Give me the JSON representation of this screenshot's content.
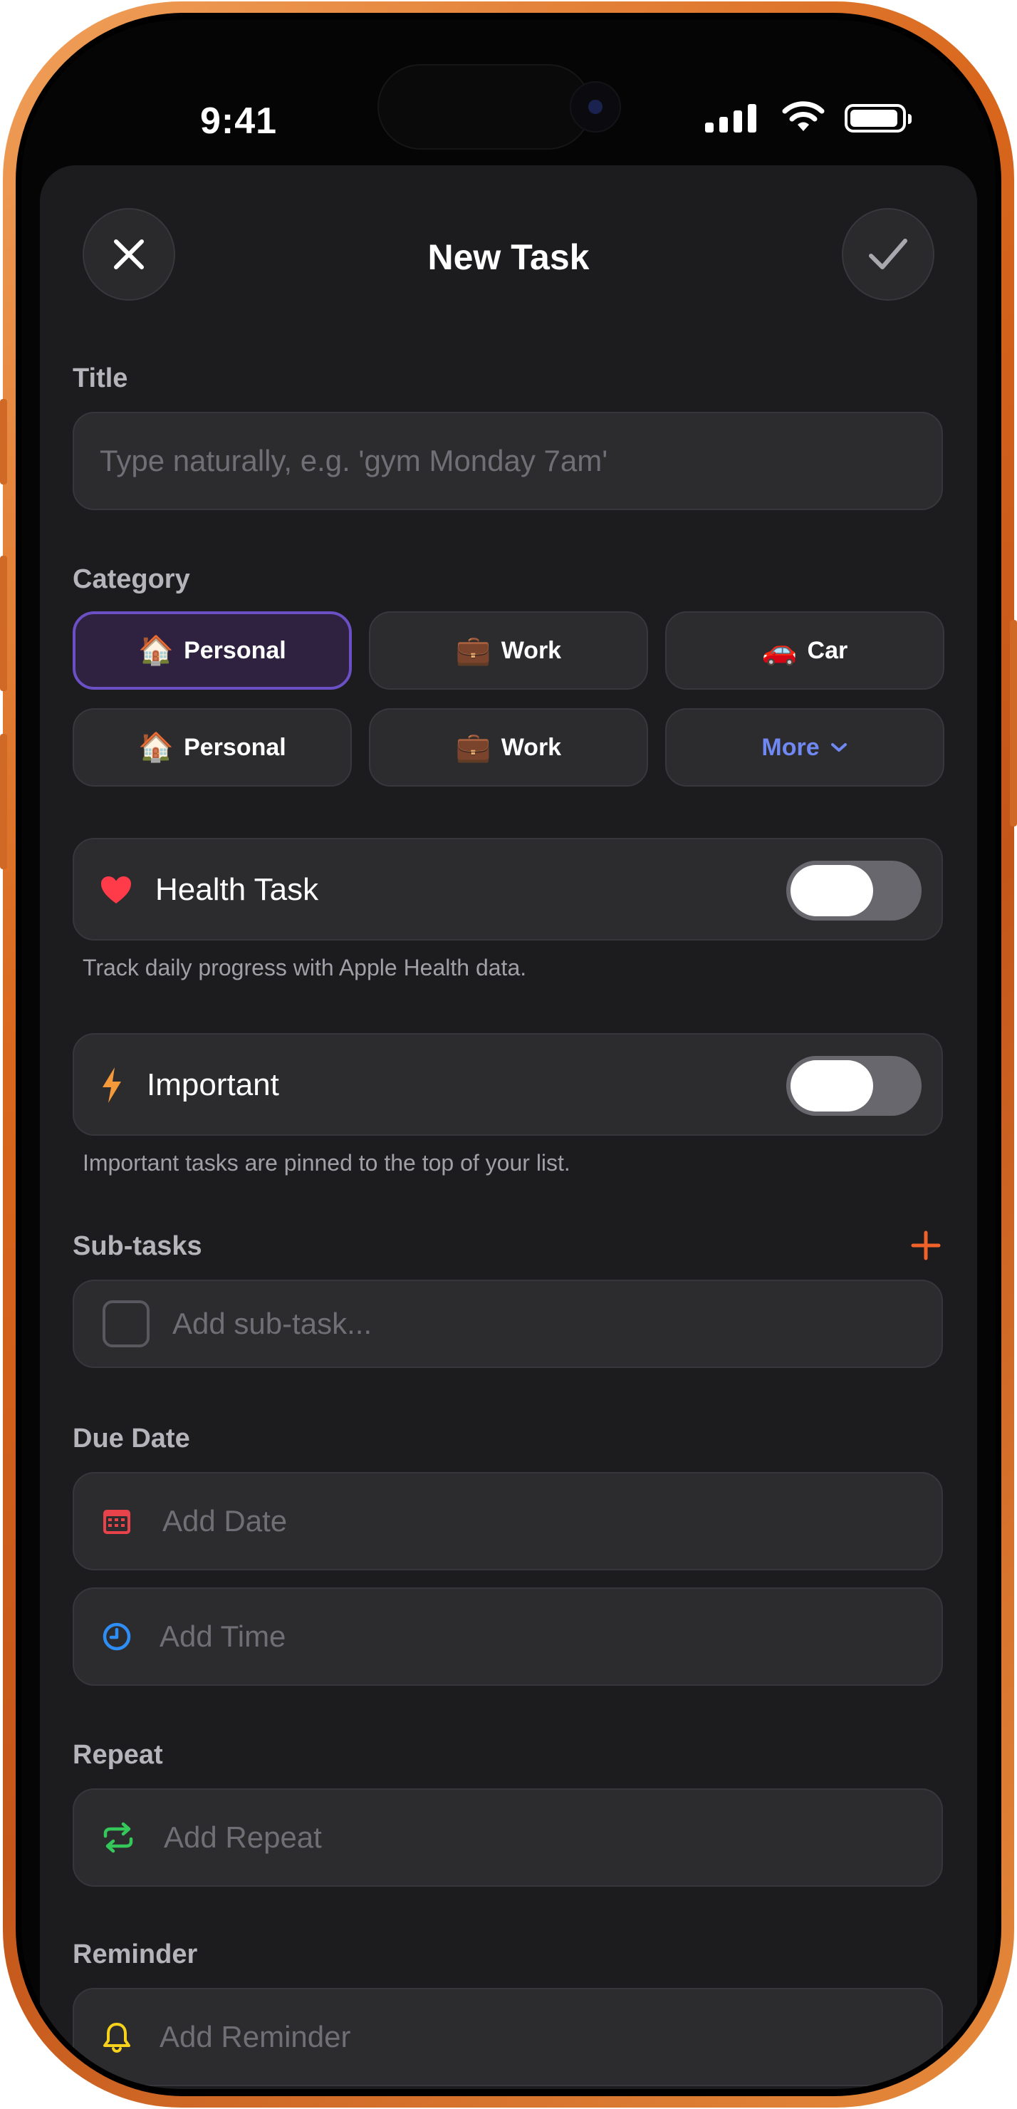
{
  "status_bar": {
    "time": "9:41"
  },
  "header": {
    "title": "New Task",
    "close_icon": "close-icon",
    "confirm_icon": "checkmark-icon"
  },
  "title_section": {
    "label": "Title",
    "placeholder": "Type naturally, e.g. 'gym Monday 7am'"
  },
  "category": {
    "label": "Category",
    "chips": [
      {
        "emoji": "🏠",
        "label": "Personal",
        "selected": true
      },
      {
        "emoji": "💼",
        "label": "Work",
        "selected": false
      },
      {
        "emoji": "🚗",
        "label": "Car",
        "selected": false
      },
      {
        "emoji": "🏠",
        "label": "Personal",
        "selected": false
      },
      {
        "emoji": "💼",
        "label": "Work",
        "selected": false
      }
    ],
    "more_label": "More"
  },
  "health_task": {
    "label": "Health Task",
    "enabled": false,
    "help": "Track daily progress with Apple Health data.",
    "icon": "heart-icon"
  },
  "important": {
    "label": "Important",
    "enabled": false,
    "help": "Important tasks are pinned to the top of your list.",
    "icon": "bolt-icon"
  },
  "subtasks": {
    "label": "Sub-tasks",
    "placeholder": "Add sub-task...",
    "add_icon": "plus-icon"
  },
  "due_date": {
    "label": "Due Date",
    "date_placeholder": "Add Date",
    "time_placeholder": "Add Time"
  },
  "repeat": {
    "label": "Repeat",
    "placeholder": "Add Repeat"
  },
  "reminder": {
    "label": "Reminder",
    "placeholder": "Add Reminder"
  },
  "colors": {
    "frame": "#d8661c",
    "sheet_bg": "#1c1c1e",
    "field_bg": "#2c2c2f",
    "selected_border": "#6b4fc4",
    "more_text": "#6f88f2",
    "add_icon": "#f0622a",
    "heart": "#ff3b4a",
    "bolt": "#f59a3a",
    "calendar": "#e8434a",
    "clock": "#2f8ef5",
    "repeat": "#34c759",
    "bell": "#f7d21d"
  }
}
